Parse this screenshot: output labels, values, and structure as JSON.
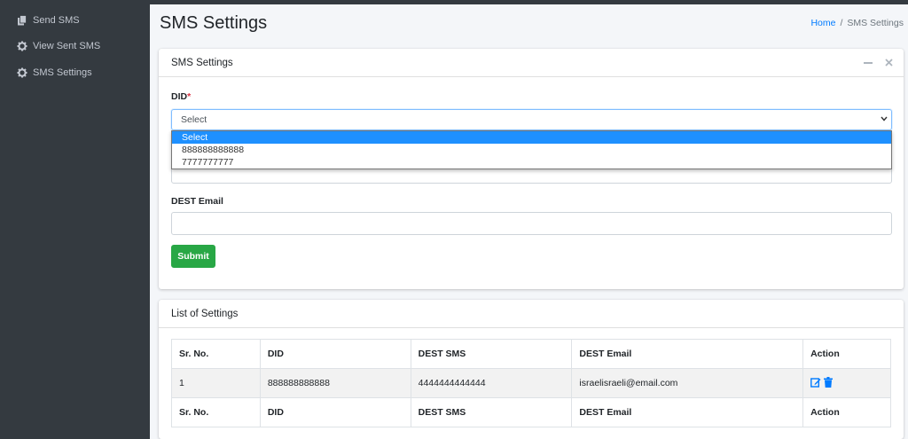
{
  "sidebar": {
    "items": [
      {
        "label": "Send SMS",
        "icon": "copy-icon"
      },
      {
        "label": "View Sent SMS",
        "icon": "gear-icon"
      },
      {
        "label": "SMS Settings",
        "icon": "gear-icon"
      }
    ]
  },
  "page": {
    "title": "SMS Settings",
    "breadcrumb": {
      "home": "Home",
      "separator": "/",
      "current": "SMS Settings"
    }
  },
  "form_card": {
    "title": "SMS Settings",
    "did_label": "DID",
    "did_required_mark": "*",
    "did_selected": "Select",
    "did_options": [
      "Select",
      "888888888888",
      "7777777777"
    ],
    "dest_email_label": "DEST Email",
    "dest_email_value": "",
    "submit_label": "Submit"
  },
  "list_card": {
    "title": "List of Settings",
    "columns": [
      "Sr. No.",
      "DID",
      "DEST SMS",
      "DEST Email",
      "Action"
    ],
    "rows": [
      {
        "sr": "1",
        "did": "888888888888",
        "dest_sms": "4444444444444",
        "dest_email": "israelisraeli@email.com"
      }
    ]
  },
  "colors": {
    "primary": "#007bff",
    "success": "#28a745",
    "sidebar": "#343a40",
    "danger": "#dc3545",
    "highlight": "#1e90ff"
  }
}
